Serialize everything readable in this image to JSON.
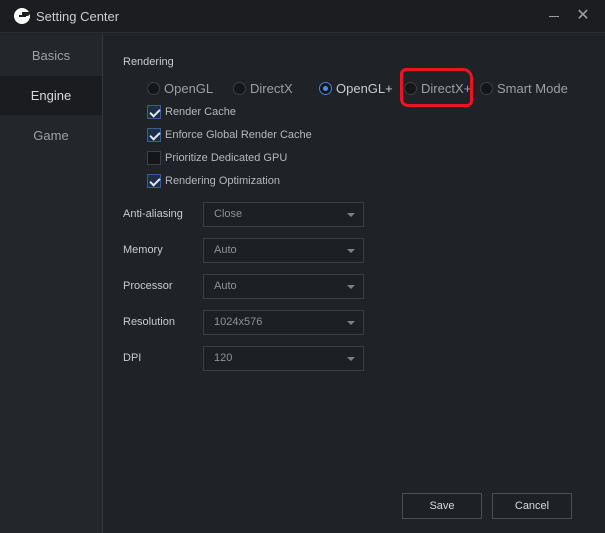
{
  "window": {
    "title": "Setting Center"
  },
  "sidebar": {
    "items": [
      {
        "label": "Basics"
      },
      {
        "label": "Engine",
        "active": true
      },
      {
        "label": "Game"
      }
    ]
  },
  "rendering": {
    "label": "Rendering",
    "options": [
      {
        "label": "OpenGL",
        "selected": false
      },
      {
        "label": "DirectX",
        "selected": false
      },
      {
        "label": "OpenGL+",
        "selected": true
      },
      {
        "label": "DirectX+",
        "selected": false
      },
      {
        "label": "Smart Mode",
        "selected": false
      }
    ],
    "checkboxes": [
      {
        "label": "Render Cache",
        "checked": true
      },
      {
        "label": "Enforce Global Render Cache",
        "checked": true
      },
      {
        "label": "Prioritize Dedicated GPU",
        "checked": false
      },
      {
        "label": "Rendering Optimization",
        "checked": true
      }
    ]
  },
  "fields": [
    {
      "label": "Anti-aliasing",
      "value": "Close"
    },
    {
      "label": "Memory",
      "value": "Auto"
    },
    {
      "label": "Processor",
      "value": "Auto"
    },
    {
      "label": "Resolution",
      "value": "1024x576"
    },
    {
      "label": "DPI",
      "value": "120"
    }
  ],
  "buttons": {
    "save": "Save",
    "cancel": "Cancel"
  },
  "colors": {
    "annotation": "#e8171f",
    "accent": "#4a8cf5",
    "background": "#1f2226"
  }
}
